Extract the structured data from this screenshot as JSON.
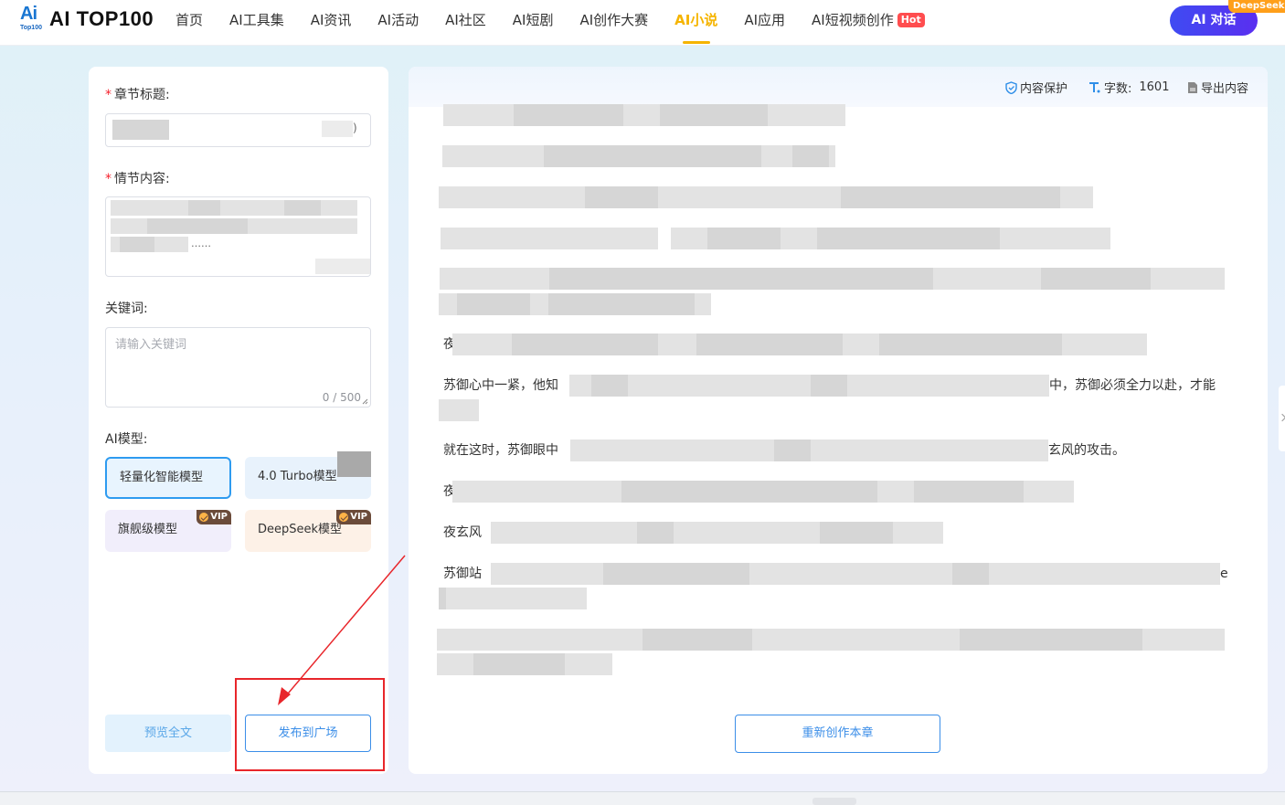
{
  "header": {
    "logo_text": "AI TOP100",
    "logo_mark": "Ai",
    "logo_sub": "Top100",
    "nav": [
      {
        "label": "首页"
      },
      {
        "label": "AI工具集"
      },
      {
        "label": "AI资讯"
      },
      {
        "label": "AI活动"
      },
      {
        "label": "AI社区"
      },
      {
        "label": "AI短剧"
      },
      {
        "label": "AI创作大赛"
      },
      {
        "label": "AI小说",
        "active": true
      },
      {
        "label": "AI应用"
      },
      {
        "label": "AI短视频创作",
        "badge": "Hot"
      }
    ],
    "chat_button": "AI 对话",
    "chat_badge": "DeepSeek"
  },
  "left_panel": {
    "chapter_title_label": "章节标题:",
    "chapter_title_suffix": ")",
    "plot_label": "情节内容:",
    "plot_ellipsis": "……",
    "keywords_label": "关键词:",
    "keywords_placeholder": "请输入关键词",
    "keywords_counter": "0 / 500",
    "model_label": "AI模型:",
    "models": [
      {
        "label": "轻量化智能模型",
        "selected": true
      },
      {
        "label": "4.0 Turbo模型"
      },
      {
        "label": "旗舰级模型",
        "badge": "VIP"
      },
      {
        "label": "DeepSeek模型",
        "badge": "VIP"
      }
    ],
    "preview_button": "预览全文",
    "publish_button": "发布到广场"
  },
  "right_panel": {
    "toolbar": {
      "protect": "内容保护",
      "word_count_label": "字数:",
      "word_count": "1601",
      "export": "导出内容"
    },
    "visible_text": {
      "p6_start": "夜",
      "p7_start": "苏御心中一紧，他知",
      "p7_end": "中，苏御必须全力以赴，才能",
      "p8_start": "就在这时，苏御眼中",
      "p8_end": "玄风的攻击。",
      "p9_start": "夜",
      "p10_start": "夜玄风",
      "p11_start": "苏御站",
      "p11_end": "e"
    },
    "recreate_button": "重新创作本章"
  },
  "colors": {
    "accent": "#3b8ee8",
    "active_nav": "#f5b400",
    "annotation": "#e8262b",
    "hot": "#ff4d4f",
    "deepseek": "#ff9f1a"
  }
}
